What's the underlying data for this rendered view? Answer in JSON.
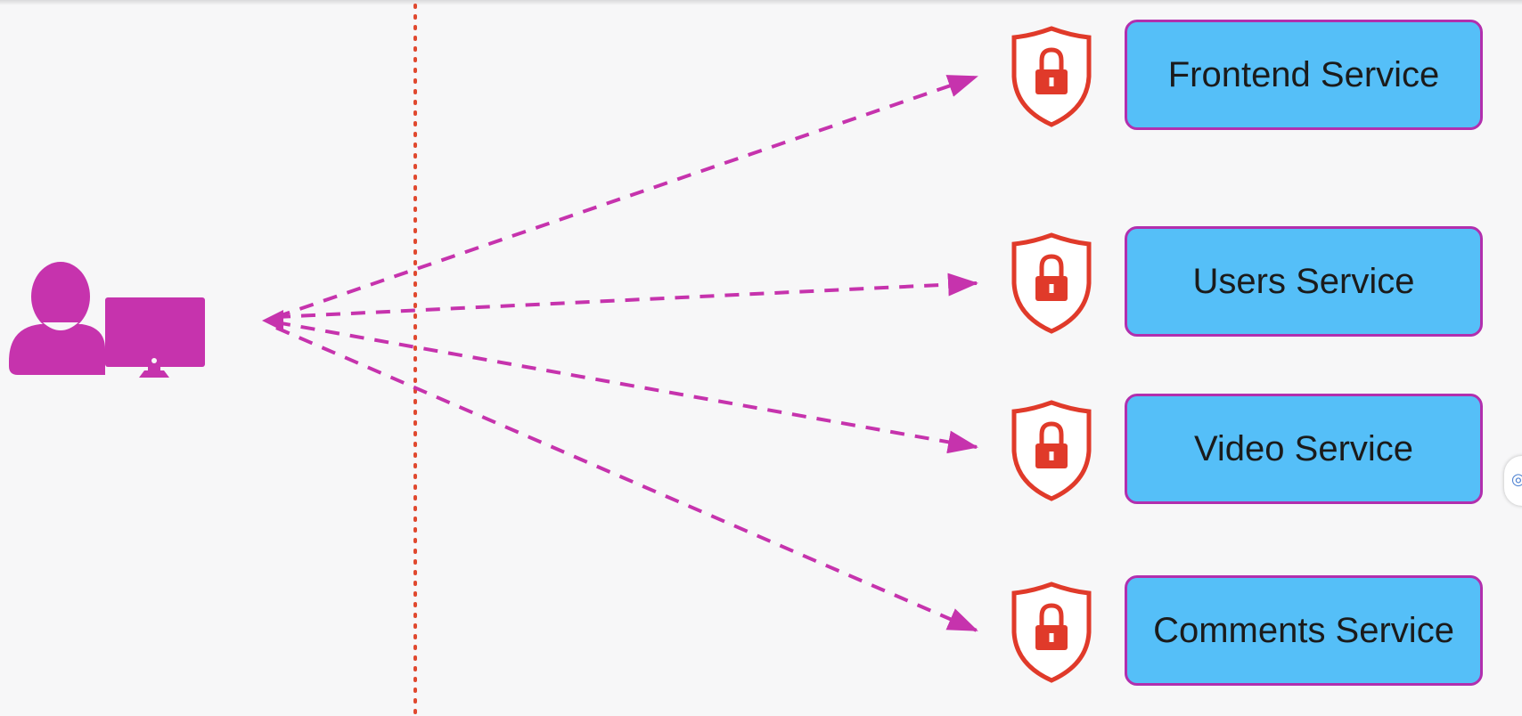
{
  "diagram": {
    "client": {
      "icon": "user-with-monitor-icon",
      "color": "#c633ad"
    },
    "boundary": {
      "style": "dotted",
      "color": "#e0492f"
    },
    "arrow_color": "#c633ad",
    "lock_icon": "shield-lock-icon",
    "lock_color": "#e03a2a",
    "box_fill": "#55bff8",
    "box_border": "#b22fae",
    "services": [
      {
        "label": "Frontend Service"
      },
      {
        "label": "Users Service"
      },
      {
        "label": "Video Service"
      },
      {
        "label": "Comments Service"
      }
    ]
  }
}
